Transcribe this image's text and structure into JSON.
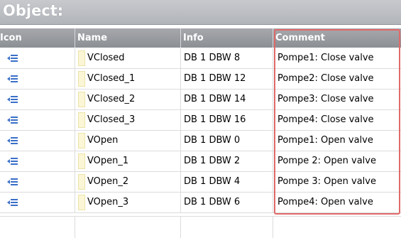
{
  "panel": {
    "title": "Object:"
  },
  "columns": [
    "Icon",
    "Name",
    "Info",
    "Comment"
  ],
  "rows": [
    {
      "name": "VClosed",
      "info": "DB 1 DBW 8",
      "comment": "Pompe1: Close valve"
    },
    {
      "name": "VClosed_1",
      "info": "DB 1 DBW 12",
      "comment": "Pompe2: Close valve"
    },
    {
      "name": "VClosed_2",
      "info": "DB 1 DBW 14",
      "comment": "Pompe3: Close valve"
    },
    {
      "name": "VClosed_3",
      "info": "DB 1 DBW 16",
      "comment": "Pompe4: Close valve"
    },
    {
      "name": "VOpen",
      "info": "DB 1 DBW 0",
      "comment": "Pompe1: Open valve"
    },
    {
      "name": "VOpen_1",
      "info": "DB 1 DBW 2",
      "comment": "Pompe 2: Open valve"
    },
    {
      "name": "VOpen_2",
      "info": "DB 1 DBW 4",
      "comment": "Pompe 3: Open valve"
    },
    {
      "name": "VOpen_3",
      "info": "DB 1 DBW 6",
      "comment": "Pompe4: Open valve"
    }
  ],
  "colors": {
    "highlight": "#e06a6a",
    "icon": "#3a6fc8",
    "header": "#9a9ca0"
  },
  "icon_name": "variable-icon"
}
